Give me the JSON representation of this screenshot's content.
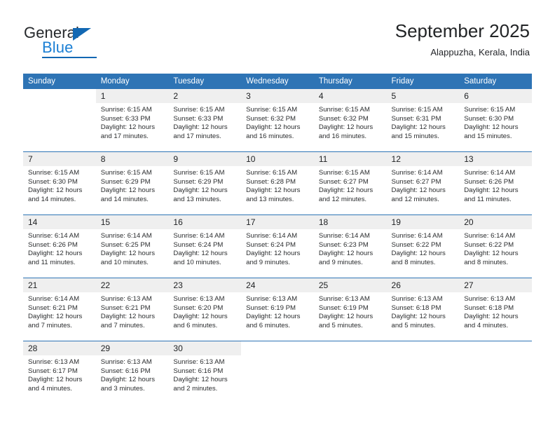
{
  "brand": {
    "name_part1": "General",
    "name_part2": "Blue",
    "triangle_icon": "brand-triangle-icon",
    "accent_color": "#1268b3",
    "secondary_color": "#1b7fd4"
  },
  "header": {
    "title": "September 2025",
    "subtitle": "Alappuzha, Kerala, India"
  },
  "theme": {
    "header_blue": "#2e74b5",
    "daynum_gray": "#efefef",
    "text_dark": "#2a2c2e"
  },
  "weekdays": [
    "Sunday",
    "Monday",
    "Tuesday",
    "Wednesday",
    "Thursday",
    "Friday",
    "Saturday"
  ],
  "weeks": [
    [
      {
        "day": "",
        "sunrise": "",
        "sunset": "",
        "daylight_line1": "",
        "daylight_line2": "",
        "empty": true
      },
      {
        "day": "1",
        "sunrise": "Sunrise: 6:15 AM",
        "sunset": "Sunset: 6:33 PM",
        "daylight_line1": "Daylight: 12 hours",
        "daylight_line2": "and 17 minutes."
      },
      {
        "day": "2",
        "sunrise": "Sunrise: 6:15 AM",
        "sunset": "Sunset: 6:33 PM",
        "daylight_line1": "Daylight: 12 hours",
        "daylight_line2": "and 17 minutes."
      },
      {
        "day": "3",
        "sunrise": "Sunrise: 6:15 AM",
        "sunset": "Sunset: 6:32 PM",
        "daylight_line1": "Daylight: 12 hours",
        "daylight_line2": "and 16 minutes."
      },
      {
        "day": "4",
        "sunrise": "Sunrise: 6:15 AM",
        "sunset": "Sunset: 6:32 PM",
        "daylight_line1": "Daylight: 12 hours",
        "daylight_line2": "and 16 minutes."
      },
      {
        "day": "5",
        "sunrise": "Sunrise: 6:15 AM",
        "sunset": "Sunset: 6:31 PM",
        "daylight_line1": "Daylight: 12 hours",
        "daylight_line2": "and 15 minutes."
      },
      {
        "day": "6",
        "sunrise": "Sunrise: 6:15 AM",
        "sunset": "Sunset: 6:30 PM",
        "daylight_line1": "Daylight: 12 hours",
        "daylight_line2": "and 15 minutes."
      }
    ],
    [
      {
        "day": "7",
        "sunrise": "Sunrise: 6:15 AM",
        "sunset": "Sunset: 6:30 PM",
        "daylight_line1": "Daylight: 12 hours",
        "daylight_line2": "and 14 minutes."
      },
      {
        "day": "8",
        "sunrise": "Sunrise: 6:15 AM",
        "sunset": "Sunset: 6:29 PM",
        "daylight_line1": "Daylight: 12 hours",
        "daylight_line2": "and 14 minutes."
      },
      {
        "day": "9",
        "sunrise": "Sunrise: 6:15 AM",
        "sunset": "Sunset: 6:29 PM",
        "daylight_line1": "Daylight: 12 hours",
        "daylight_line2": "and 13 minutes."
      },
      {
        "day": "10",
        "sunrise": "Sunrise: 6:15 AM",
        "sunset": "Sunset: 6:28 PM",
        "daylight_line1": "Daylight: 12 hours",
        "daylight_line2": "and 13 minutes."
      },
      {
        "day": "11",
        "sunrise": "Sunrise: 6:15 AM",
        "sunset": "Sunset: 6:27 PM",
        "daylight_line1": "Daylight: 12 hours",
        "daylight_line2": "and 12 minutes."
      },
      {
        "day": "12",
        "sunrise": "Sunrise: 6:14 AM",
        "sunset": "Sunset: 6:27 PM",
        "daylight_line1": "Daylight: 12 hours",
        "daylight_line2": "and 12 minutes."
      },
      {
        "day": "13",
        "sunrise": "Sunrise: 6:14 AM",
        "sunset": "Sunset: 6:26 PM",
        "daylight_line1": "Daylight: 12 hours",
        "daylight_line2": "and 11 minutes."
      }
    ],
    [
      {
        "day": "14",
        "sunrise": "Sunrise: 6:14 AM",
        "sunset": "Sunset: 6:26 PM",
        "daylight_line1": "Daylight: 12 hours",
        "daylight_line2": "and 11 minutes."
      },
      {
        "day": "15",
        "sunrise": "Sunrise: 6:14 AM",
        "sunset": "Sunset: 6:25 PM",
        "daylight_line1": "Daylight: 12 hours",
        "daylight_line2": "and 10 minutes."
      },
      {
        "day": "16",
        "sunrise": "Sunrise: 6:14 AM",
        "sunset": "Sunset: 6:24 PM",
        "daylight_line1": "Daylight: 12 hours",
        "daylight_line2": "and 10 minutes."
      },
      {
        "day": "17",
        "sunrise": "Sunrise: 6:14 AM",
        "sunset": "Sunset: 6:24 PM",
        "daylight_line1": "Daylight: 12 hours",
        "daylight_line2": "and 9 minutes."
      },
      {
        "day": "18",
        "sunrise": "Sunrise: 6:14 AM",
        "sunset": "Sunset: 6:23 PM",
        "daylight_line1": "Daylight: 12 hours",
        "daylight_line2": "and 9 minutes."
      },
      {
        "day": "19",
        "sunrise": "Sunrise: 6:14 AM",
        "sunset": "Sunset: 6:22 PM",
        "daylight_line1": "Daylight: 12 hours",
        "daylight_line2": "and 8 minutes."
      },
      {
        "day": "20",
        "sunrise": "Sunrise: 6:14 AM",
        "sunset": "Sunset: 6:22 PM",
        "daylight_line1": "Daylight: 12 hours",
        "daylight_line2": "and 8 minutes."
      }
    ],
    [
      {
        "day": "21",
        "sunrise": "Sunrise: 6:14 AM",
        "sunset": "Sunset: 6:21 PM",
        "daylight_line1": "Daylight: 12 hours",
        "daylight_line2": "and 7 minutes."
      },
      {
        "day": "22",
        "sunrise": "Sunrise: 6:13 AM",
        "sunset": "Sunset: 6:21 PM",
        "daylight_line1": "Daylight: 12 hours",
        "daylight_line2": "and 7 minutes."
      },
      {
        "day": "23",
        "sunrise": "Sunrise: 6:13 AM",
        "sunset": "Sunset: 6:20 PM",
        "daylight_line1": "Daylight: 12 hours",
        "daylight_line2": "and 6 minutes."
      },
      {
        "day": "24",
        "sunrise": "Sunrise: 6:13 AM",
        "sunset": "Sunset: 6:19 PM",
        "daylight_line1": "Daylight: 12 hours",
        "daylight_line2": "and 6 minutes."
      },
      {
        "day": "25",
        "sunrise": "Sunrise: 6:13 AM",
        "sunset": "Sunset: 6:19 PM",
        "daylight_line1": "Daylight: 12 hours",
        "daylight_line2": "and 5 minutes."
      },
      {
        "day": "26",
        "sunrise": "Sunrise: 6:13 AM",
        "sunset": "Sunset: 6:18 PM",
        "daylight_line1": "Daylight: 12 hours",
        "daylight_line2": "and 5 minutes."
      },
      {
        "day": "27",
        "sunrise": "Sunrise: 6:13 AM",
        "sunset": "Sunset: 6:18 PM",
        "daylight_line1": "Daylight: 12 hours",
        "daylight_line2": "and 4 minutes."
      }
    ],
    [
      {
        "day": "28",
        "sunrise": "Sunrise: 6:13 AM",
        "sunset": "Sunset: 6:17 PM",
        "daylight_line1": "Daylight: 12 hours",
        "daylight_line2": "and 4 minutes."
      },
      {
        "day": "29",
        "sunrise": "Sunrise: 6:13 AM",
        "sunset": "Sunset: 6:16 PM",
        "daylight_line1": "Daylight: 12 hours",
        "daylight_line2": "and 3 minutes."
      },
      {
        "day": "30",
        "sunrise": "Sunrise: 6:13 AM",
        "sunset": "Sunset: 6:16 PM",
        "daylight_line1": "Daylight: 12 hours",
        "daylight_line2": "and 2 minutes."
      },
      {
        "day": "",
        "sunrise": "",
        "sunset": "",
        "daylight_line1": "",
        "daylight_line2": "",
        "empty": true
      },
      {
        "day": "",
        "sunrise": "",
        "sunset": "",
        "daylight_line1": "",
        "daylight_line2": "",
        "empty": true
      },
      {
        "day": "",
        "sunrise": "",
        "sunset": "",
        "daylight_line1": "",
        "daylight_line2": "",
        "empty": true
      },
      {
        "day": "",
        "sunrise": "",
        "sunset": "",
        "daylight_line1": "",
        "daylight_line2": "",
        "empty": true
      }
    ]
  ]
}
